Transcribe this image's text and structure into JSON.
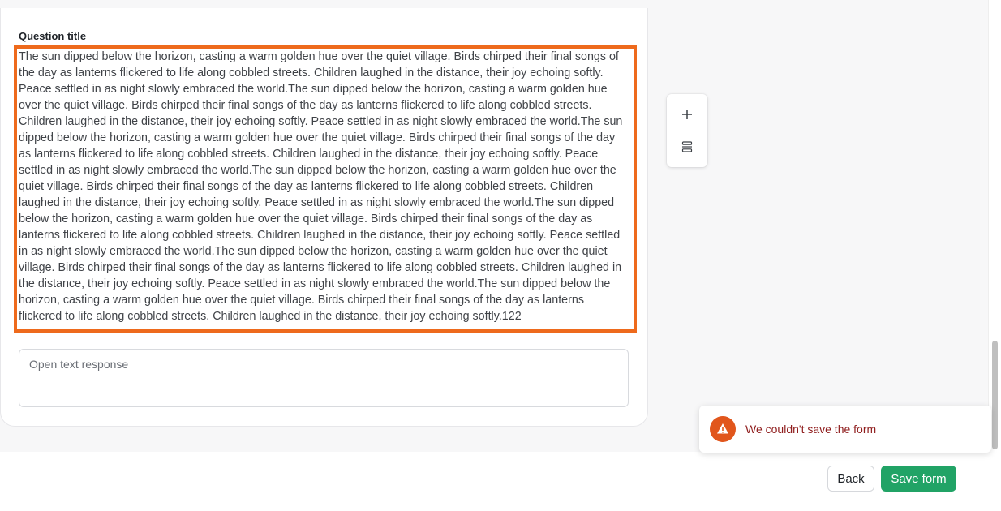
{
  "question": {
    "label": "Question title",
    "title_text": "The sun dipped below the horizon, casting a warm golden hue over the quiet village. Birds chirped their final songs of the day as lanterns flickered to life along cobbled streets. Children laughed in the distance, their joy echoing softly. Peace settled in as night slowly embraced the world.The sun dipped below the horizon, casting a warm golden hue over the quiet village. Birds chirped their final songs of the day as lanterns flickered to life along cobbled streets. Children laughed in the distance, their joy echoing softly. Peace settled in as night slowly embraced the world.The sun dipped below the horizon, casting a warm golden hue over the quiet village. Birds chirped their final songs of the day as lanterns flickered to life along cobbled streets. Children laughed in the distance, their joy echoing softly. Peace settled in as night slowly embraced the world.The sun dipped below the horizon, casting a warm golden hue over the quiet village. Birds chirped their final songs of the day as lanterns flickered to life along cobbled streets. Children laughed in the distance, their joy echoing softly. Peace settled in as night slowly embraced the world.The sun dipped below the horizon, casting a warm golden hue over the quiet village. Birds chirped their final songs of the day as lanterns flickered to life along cobbled streets. Children laughed in the distance, their joy echoing softly. Peace settled in as night slowly embraced the world.The sun dipped below the horizon, casting a warm golden hue over the quiet village. Birds chirped their final songs of the day as lanterns flickered to life along cobbled streets. Children laughed in the distance, their joy echoing softly. Peace settled in as night slowly embraced the world.The sun dipped below the horizon, casting a warm golden hue over the quiet village. Birds chirped their final songs of the day as lanterns flickered to life along cobbled streets. Children laughed in the distance, their joy echoing softly.122",
    "title_border_color": "#ee6a1c",
    "response_placeholder": "Open text response"
  },
  "toolbar": {
    "add_icon": "plus-icon",
    "layout_icon": "stack-layout-icon"
  },
  "toast": {
    "message": "We couldn't save the form",
    "icon": "warning-triangle-icon",
    "icon_color": "#e1561c"
  },
  "footer": {
    "back_label": "Back",
    "save_label": "Save form",
    "save_color": "#21a366"
  }
}
